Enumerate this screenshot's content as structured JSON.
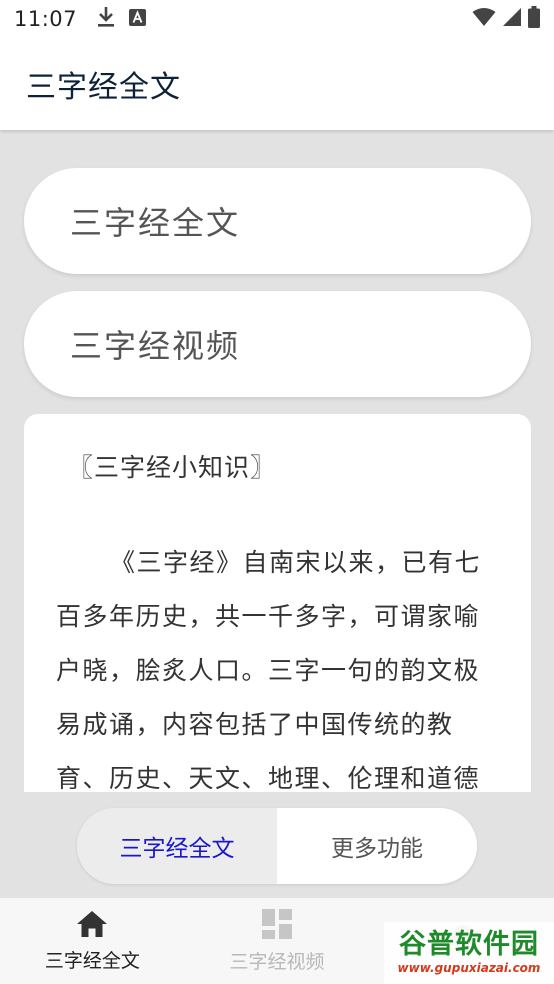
{
  "status_bar": {
    "time": "11:07",
    "icons": [
      "download-icon",
      "a-box-icon",
      "wifi-icon",
      "signal-icon",
      "battery-icon"
    ]
  },
  "app_bar": {
    "title": "三字经全文"
  },
  "menu": {
    "buttons": [
      {
        "label": "三字经全文"
      },
      {
        "label": "三字经视频"
      }
    ]
  },
  "card": {
    "heading": "〖三字经小知识〗",
    "body": "《三字经》自南宋以来，已有七百多年历史，共一千多字，可谓家喻户晓，脍炙人口。三字一句的韵文极易成诵，内容包括了中国传统的教育、历史、天文、地理、伦理和道德"
  },
  "segmented": {
    "active_label": "三字经全文",
    "inactive_label": "更多功能"
  },
  "bottom_nav": {
    "items": [
      {
        "label": "三字经全文",
        "icon": "home-icon"
      },
      {
        "label": "三字经视频",
        "icon": "grid-icon"
      }
    ]
  },
  "watermark": {
    "main": "谷普软件园",
    "sub": "www.gupuxiazai.com"
  },
  "colors": {
    "accent": "#1a17c8",
    "background": "#e2e2e2",
    "title": "#0d2238",
    "watermark_green": "#1f8a2a"
  }
}
